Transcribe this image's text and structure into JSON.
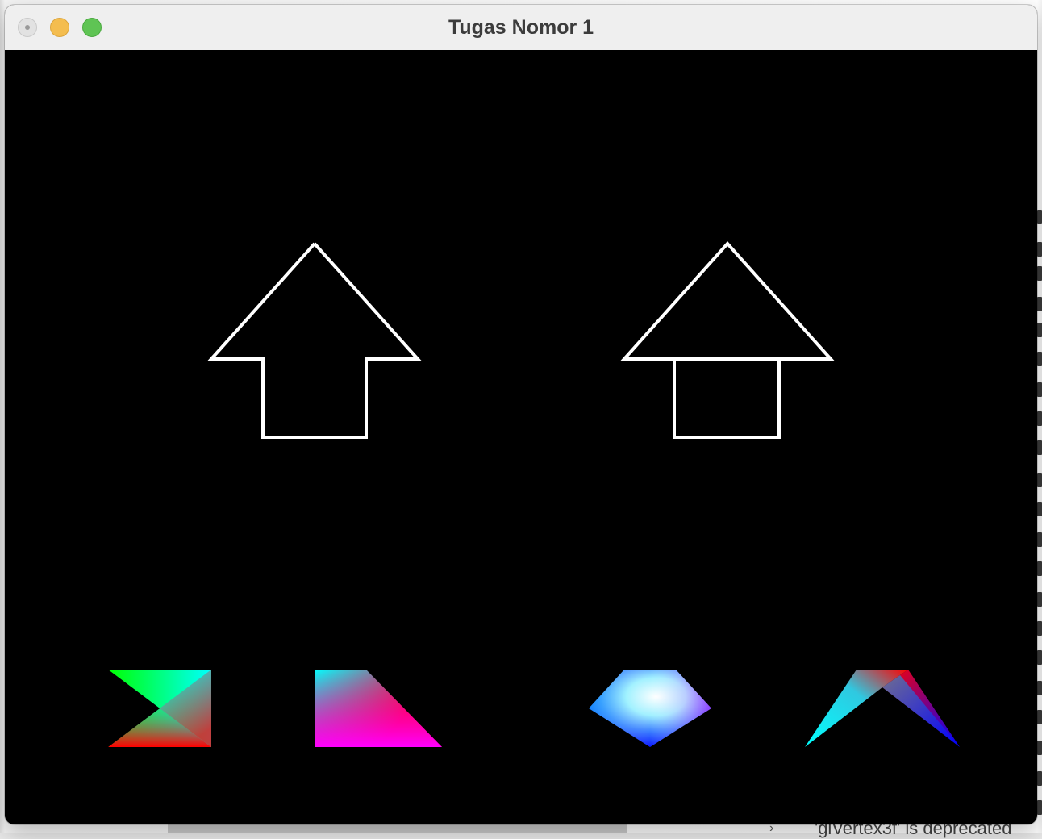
{
  "window": {
    "title": "Tugas Nomor 1"
  },
  "background_app": {
    "footer_text": "'glVertex3f' is deprecated",
    "footer_chevron": "›"
  },
  "colors": {
    "canvas_background": "#000000",
    "outline_stroke": "#ffffff",
    "close_button": "#e2e2e2",
    "minimize_button": "#f4bd4f",
    "zoom_button": "#5fc454"
  }
}
